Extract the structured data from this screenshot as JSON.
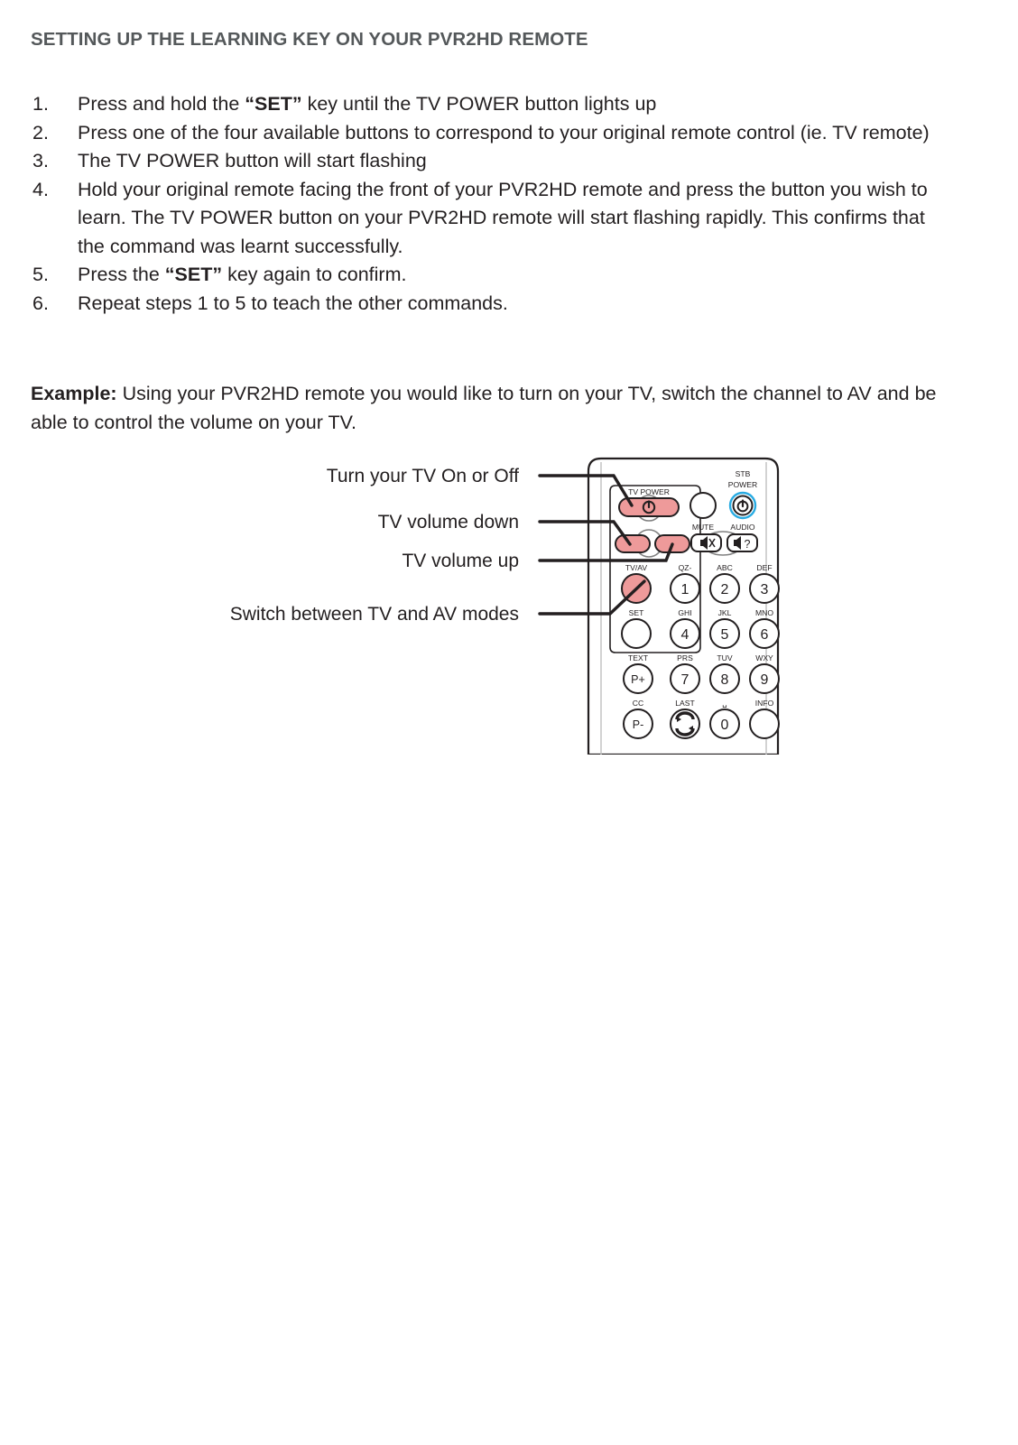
{
  "document": {
    "title": "SETTING UP THE LEARNING KEY ON YOUR PVR2HD REMOTE",
    "title_color": "#54585A"
  },
  "steps": [
    {
      "num": "1.",
      "html": "Press and hold the <b>“SET”</b> key until the TV POWER button lights up"
    },
    {
      "num": "2.",
      "html": "Press one of the four available buttons to correspond to your original remote control (ie. TV remote)"
    },
    {
      "num": "3.",
      "html": "The TV POWER button will start flashing"
    },
    {
      "num": "4.",
      "html": "Hold your original remote facing the front of your PVR2HD remote and press the button you wish to learn. The TV POWER button on your PVR2HD remote will start flashing rapidly. This confirms that the command was learnt successfully."
    },
    {
      "num": "5.",
      "html": "Press the <b>“SET”</b> key again to confirm."
    },
    {
      "num": "6.",
      "html": "Repeat steps 1 to 5 to teach the other commands."
    }
  ],
  "example": {
    "label": "Example:",
    "body": " Using your PVR2HD remote you would like to turn on your TV, switch the channel to AV and be able to control the volume on your TV."
  },
  "figure": {
    "callouts": [
      {
        "id": "tv-power",
        "label": "Turn your TV On or Off"
      },
      {
        "id": "vol-down",
        "label": "TV volume down"
      },
      {
        "id": "vol-up",
        "label": "TV volume up"
      },
      {
        "id": "tv-av",
        "label": "Switch between TV and AV modes"
      }
    ],
    "remote": {
      "highlight_color": "#EE9A9A",
      "highlight_stroke": "#C1272D",
      "accent_ring_color": "#29ABE2",
      "body_stroke": "#231F20",
      "learn_group_labels": {
        "tv_power": "TV POWER",
        "tv_av": "TV/AV",
        "set": "SET"
      },
      "right_labels": {
        "stb_power_line1": "STB",
        "stb_power_line2": "POWER",
        "mute": "MUTE",
        "audio": "AUDIO"
      },
      "keypad": [
        {
          "top": "QZ-",
          "key": "1"
        },
        {
          "top": "ABC",
          "key": "2"
        },
        {
          "top": "DEF",
          "key": "3"
        },
        {
          "top": "GHI",
          "key": "4"
        },
        {
          "top": "JKL",
          "key": "5"
        },
        {
          "top": "MNO",
          "key": "6"
        },
        {
          "top": "TEXT",
          "key": "P+"
        },
        {
          "top": "PRS",
          "key": "7"
        },
        {
          "top": "TUV",
          "key": "8"
        },
        {
          "top": "WXY",
          "key": "9"
        },
        {
          "top": "CC",
          "key": "P-"
        },
        {
          "top": "LAST",
          "key": ""
        },
        {
          "top": "␣",
          "key": "0"
        },
        {
          "top": "INFO",
          "key": ""
        }
      ]
    }
  }
}
